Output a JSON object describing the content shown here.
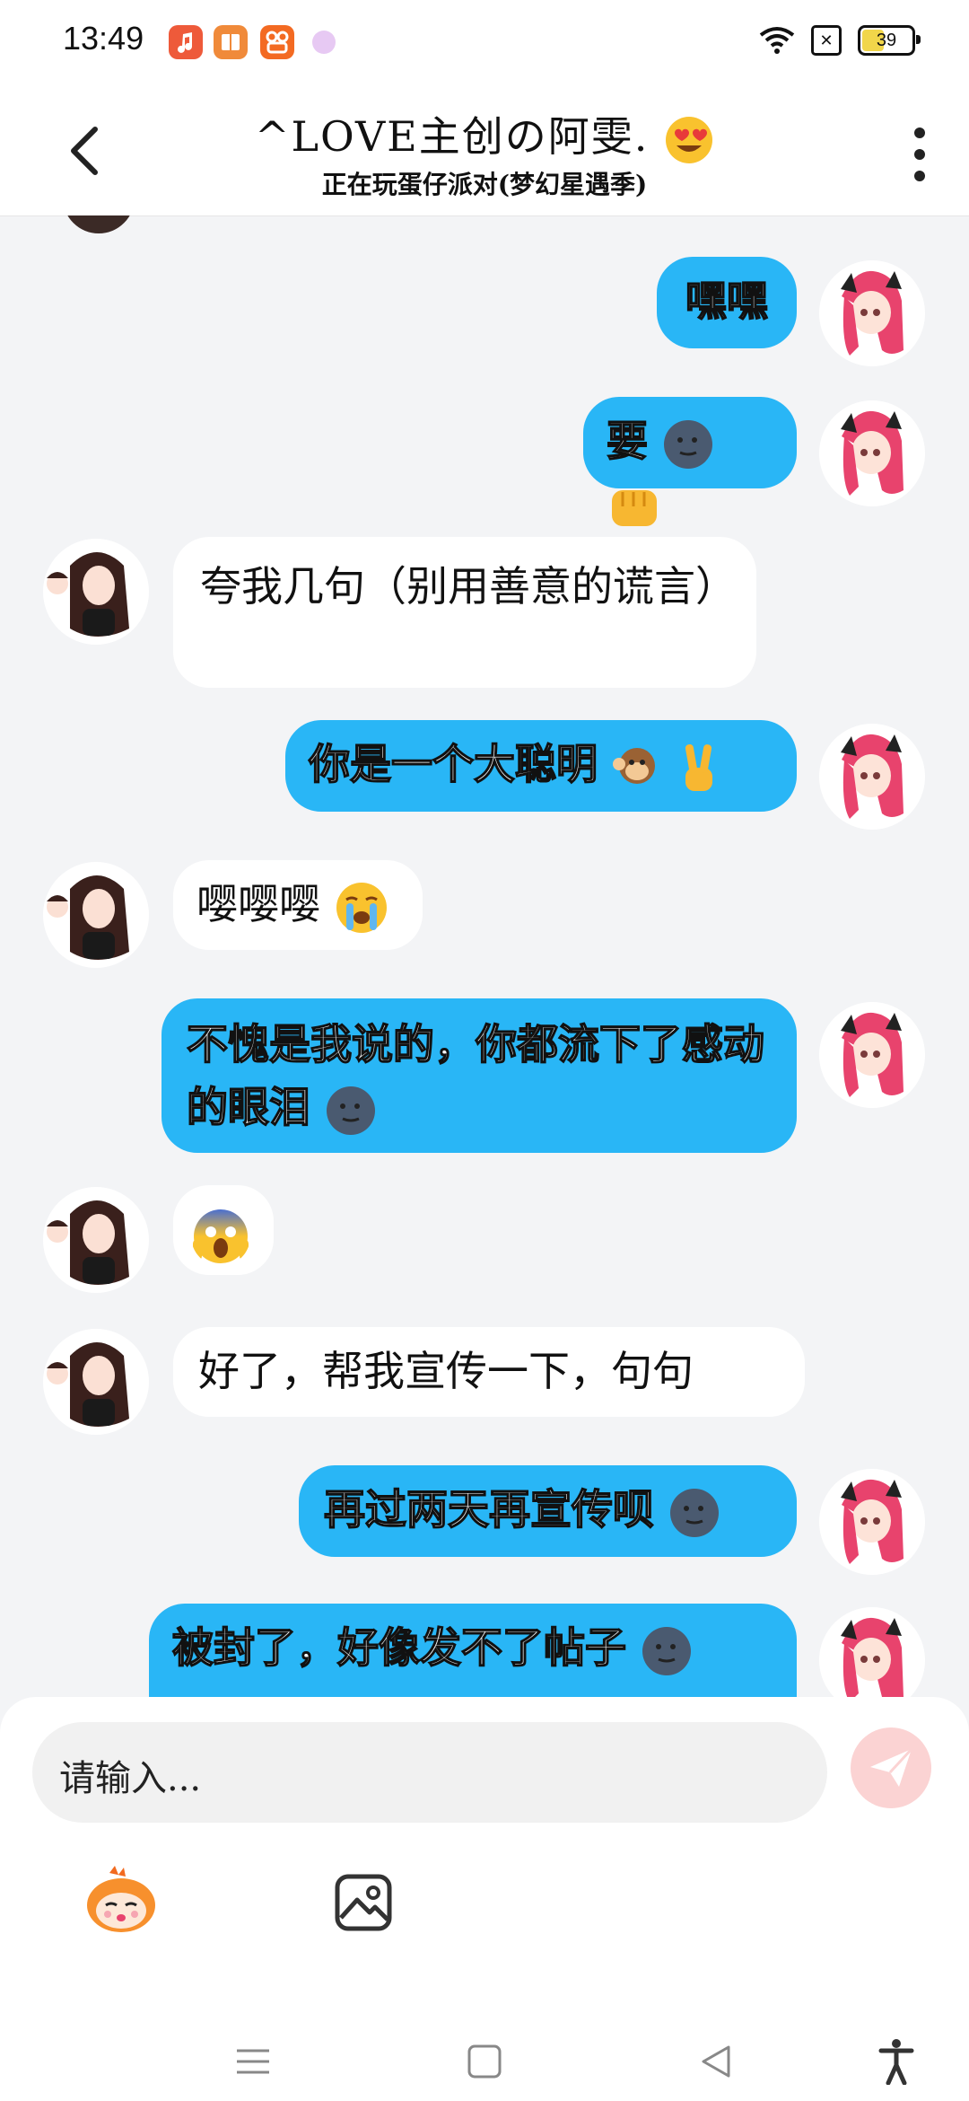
{
  "status_bar": {
    "time": "13:49",
    "battery_level": "39",
    "icons": [
      "music-app-icon",
      "reader-app-icon",
      "kuaishou-app-icon",
      "ball-app-icon",
      "wifi-icon",
      "sim-off-icon",
      "battery-icon"
    ]
  },
  "header": {
    "title": "^LOVE主创の阿雯.",
    "title_emoji": "heart-eyes-emoji",
    "subtitle": "正在玩蛋仔派对(梦幻星遇季)"
  },
  "messages": [
    {
      "side": "me",
      "text": "嘿嘿",
      "emojis": []
    },
    {
      "side": "me",
      "text": "要",
      "emojis": [
        "moon-face-emoji",
        "fist-emoji"
      ]
    },
    {
      "side": "them",
      "text": "夸我几句（别用善意的谎言）",
      "emojis": []
    },
    {
      "side": "me",
      "text": "你是一个大聪明",
      "emojis": [
        "monkey-emoji",
        "victory-hand-emoji"
      ]
    },
    {
      "side": "them",
      "text": "嘤嘤嘤",
      "emojis": [
        "crying-face-emoji"
      ]
    },
    {
      "side": "me",
      "text": "不愧是我说的，你都流下了感动的眼泪",
      "emojis": [
        "moon-face-emoji"
      ]
    },
    {
      "side": "them",
      "text": "",
      "emojis": [
        "scream-face-emoji"
      ]
    },
    {
      "side": "them",
      "text": "好了，帮我宣传一下，句句",
      "emojis": []
    },
    {
      "side": "me",
      "text": "再过两天再宣传呗",
      "emojis": [
        "moon-face-emoji"
      ]
    },
    {
      "side": "me",
      "text": "被封了，好像发不了帖子",
      "emojis": [
        "moon-face-emoji"
      ]
    }
  ],
  "input": {
    "placeholder": "请输入..."
  },
  "colors": {
    "my_bubble": "#29b6f6",
    "their_bubble": "#ffffff",
    "background": "#f3f4f6",
    "send_button_disabled": "#fbd3d3"
  }
}
